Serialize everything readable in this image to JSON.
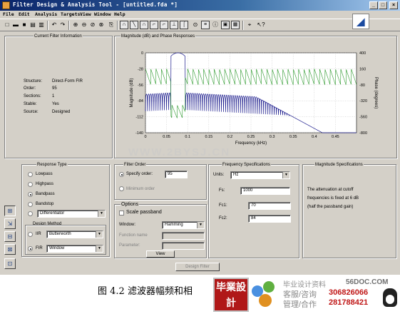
{
  "window": {
    "title": "Filter Design & Analysis Tool - [untitled.fda *]",
    "controls": [
      "_",
      "□",
      "×"
    ]
  },
  "menu": [
    "File",
    "Edit",
    "Analysis",
    "Targets",
    "View",
    "Window",
    "Help"
  ],
  "toolbar_icons": [
    "new-icon",
    "open-icon",
    "save-icon",
    "print-icon",
    "print-preview-icon",
    "undo-icon",
    "redo-icon",
    "zoom-in-icon",
    "zoom-out-icon",
    "zoom-x-icon",
    "zoom-y-icon",
    "full-view-icon",
    "magnitude-icon",
    "phase-icon",
    "magnitude-phase-icon",
    "group-delay-icon",
    "phase-delay-icon",
    "impulse-icon",
    "step-icon",
    "pole-zero-icon",
    "coefficients-icon",
    "info-icon",
    "filter-structure-icon",
    "noise-icon",
    "data-cursor-icon",
    "whats-this-icon"
  ],
  "current_filter": {
    "title": "Current Filter Information",
    "rows": [
      {
        "label": "Structure:",
        "value": "Direct-Form FIR"
      },
      {
        "label": "Order:",
        "value": "95"
      },
      {
        "label": "Sections:",
        "value": "1"
      },
      {
        "label": "Stable:",
        "value": "Yes"
      },
      {
        "label": "Source:",
        "value": "Designed"
      }
    ]
  },
  "response_panel": {
    "title": "Magnitude (dB) and Phase Responses"
  },
  "response_type": {
    "title": "Response Type",
    "options": [
      "Lowpass",
      "Highpass",
      "Bandpass",
      "Bandstop"
    ],
    "selected": "Bandpass",
    "other_value": "Differentiator"
  },
  "design_method": {
    "title": "Design Method",
    "iir_label": "IIR",
    "iir_value": "Butterworth",
    "fir_label": "FIR",
    "fir_value": "Window",
    "selected": "FIR"
  },
  "filter_order": {
    "title": "Filter Order",
    "specify_label": "Specify order:",
    "specify_value": "95",
    "minimum_label": "Minimum order"
  },
  "options": {
    "title": "Options",
    "scale_label": "Scale passband",
    "window_label": "Window:",
    "window_value": "Hamming",
    "function_label": "Function name",
    "parameter_label": "Parameter:",
    "view_button": "View"
  },
  "freq_spec": {
    "title": "Frequency Specifications",
    "units_label": "Units:",
    "units_value": "Hz",
    "fs_label": "Fs:",
    "fs_value": "1000",
    "fc1_label": "Fc1:",
    "fc1_value": "70",
    "fc2_label": "Fc2:",
    "fc2_value": "84"
  },
  "mag_spec": {
    "title": "Magnitude Specifications",
    "text_lines": [
      "The attenuation at cutoff",
      "frequencies is fixed at 6 dB",
      "(half the passband gain)"
    ]
  },
  "design_button": "Design Filter",
  "side_icons": [
    "design-filter-icon",
    "import-filter-icon",
    "quantize-icon",
    "transform-icon",
    "realize-model-icon"
  ],
  "caption": "图 4.2  滤波器幅频和相",
  "watermark": "WWW.2BYSJ.CN",
  "promo": {
    "badge": "毕業設計",
    "line1": "毕业设计资料",
    "site": "56DOC.COM",
    "line2": "客服/咨询",
    "number1": "306826066",
    "line3": "管理/合作",
    "number2": "281788421"
  },
  "chart_data": {
    "type": "line",
    "xlabel": "Frequency (kHz)",
    "ylabel": "Magnitude (dB)",
    "y2label": "Phase (degrees)",
    "xlim": [
      0,
      0.5
    ],
    "ylim": [
      -140,
      0
    ],
    "y2lim": [
      -800,
      400
    ],
    "xticks": [
      "0",
      "0.05",
      "0.1",
      "0.15",
      "0.2",
      "0.25",
      "0.3",
      "0.35",
      "0.4",
      "0.45"
    ],
    "yticks": [
      "0",
      "-28",
      "-56",
      "-84",
      "-112",
      "-140"
    ],
    "y2ticks": [
      "400",
      "160",
      "-80",
      "-320",
      "-560",
      "-800"
    ],
    "grid": true,
    "series": [
      {
        "color": "#1a1a8c",
        "passband": [
          0.07,
          0.084
        ],
        "sidelobe_floor_db": -70
      },
      {
        "color": "#2e9a2e",
        "phase_range_deg": [
          -80,
          160
        ]
      }
    ]
  }
}
